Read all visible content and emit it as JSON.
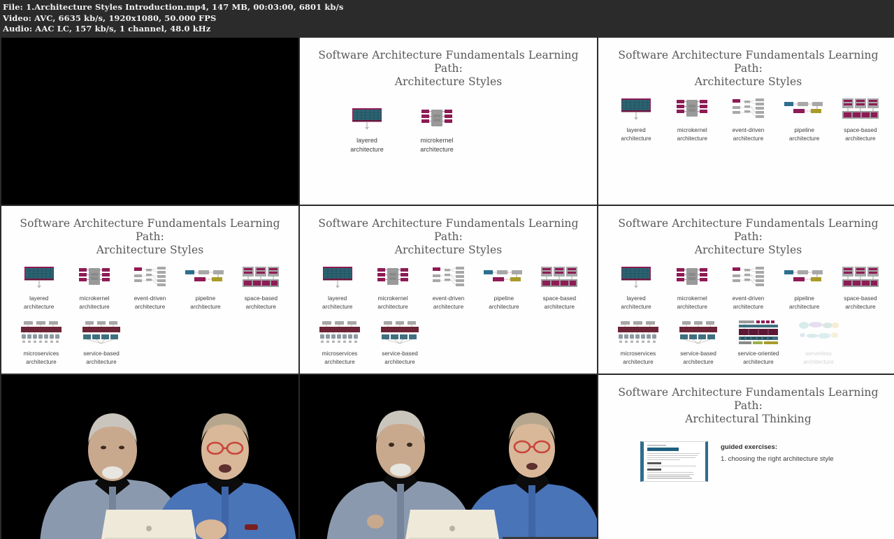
{
  "mediainfo": {
    "line1": "File: 1.Architecture Styles Introduction.mp4, 147 MB, 00:03:00, 6801 kb/s",
    "line2": "Video: AVC, 6635 kb/s, 1920x1080, 50.000 FPS",
    "line3": "Audio: AAC LC, 157 kb/s, 1 channel, 48.0 kHz"
  },
  "colors": {
    "header_bg": "#2b2b2b",
    "slide_bg": "#fefefe",
    "title_text": "#58585a",
    "label_text": "#3c3c3c",
    "magenta": "#8e1b55",
    "teal": "#2d6f7e",
    "grey": "#9a9a9a",
    "olive": "#a99b2a",
    "maroon": "#6d2436",
    "doc_accent": "#2e6d8e"
  },
  "titles": {
    "styles": "Software Architecture Fundamentals Learning Path:\nArchitecture Styles",
    "styles_l1": "Software Architecture Fundamentals Learning Path:",
    "styles_l2": "Architecture Styles",
    "thinking_l1": "Software Architecture Fundamentals Learning Path:",
    "thinking_l2": "Architectural Thinking"
  },
  "styles": {
    "layered": {
      "label_l1": "layered",
      "label_l2": "architecture",
      "icon": "layered-architecture-icon"
    },
    "microkernel": {
      "label_l1": "microkernel",
      "label_l2": "architecture",
      "icon": "microkernel-architecture-icon"
    },
    "event": {
      "label_l1": "event-driven",
      "label_l2": "architecture",
      "icon": "event-driven-architecture-icon"
    },
    "pipeline": {
      "label_l1": "pipeline",
      "label_l2": "architecture",
      "icon": "pipeline-architecture-icon"
    },
    "space": {
      "label_l1": "space-based",
      "label_l2": "architecture",
      "icon": "space-based-architecture-icon"
    },
    "microservices": {
      "label_l1": "microservices",
      "label_l2": "architecture",
      "icon": "microservices-architecture-icon"
    },
    "servicebased": {
      "label_l1": "service-based",
      "label_l2": "architecture",
      "icon": "service-based-architecture-icon"
    },
    "serviceoriented": {
      "label_l1": "service-oriented",
      "label_l2": "architecture",
      "icon": "service-oriented-architecture-icon"
    },
    "serverless": {
      "label_l1": "serverless",
      "label_l2": "architecture",
      "icon": "serverless-architecture-icon"
    }
  },
  "guided": {
    "heading": "guided exercises:",
    "item1": "1. choosing the right architecture style",
    "doc_title": "Going Going Gone!",
    "doc_sup": "The Architecture Kata"
  },
  "cells": [
    {
      "index": 1,
      "type": "video",
      "name": "video-thumbnail-1"
    },
    {
      "index": 2,
      "type": "slide",
      "name": "slide-thumbnail-2"
    },
    {
      "index": 3,
      "type": "slide",
      "name": "slide-thumbnail-3"
    },
    {
      "index": 4,
      "type": "slide",
      "name": "slide-thumbnail-4"
    },
    {
      "index": 5,
      "type": "slide",
      "name": "slide-thumbnail-5"
    },
    {
      "index": 6,
      "type": "slide",
      "name": "slide-thumbnail-6"
    },
    {
      "index": 7,
      "type": "video",
      "name": "video-thumbnail-7"
    },
    {
      "index": 8,
      "type": "video",
      "name": "video-thumbnail-8"
    },
    {
      "index": 9,
      "type": "slide",
      "name": "slide-thumbnail-9"
    }
  ]
}
